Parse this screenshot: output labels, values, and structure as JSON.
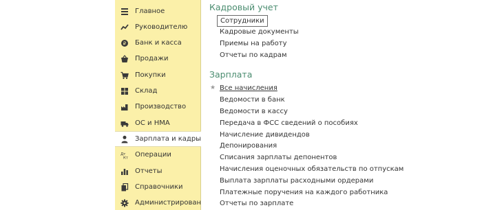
{
  "sidebar": {
    "items": [
      {
        "label": "Главное",
        "icon": "menu-lines-icon"
      },
      {
        "label": "Руководителю",
        "icon": "trend-chart-icon"
      },
      {
        "label": "Банк и касса",
        "icon": "coin-icon"
      },
      {
        "label": "Продажи",
        "icon": "shopping-basket-icon"
      },
      {
        "label": "Покупки",
        "icon": "shopping-cart-icon"
      },
      {
        "label": "Склад",
        "icon": "warehouse-grid-icon"
      },
      {
        "label": "Производство",
        "icon": "factory-icon"
      },
      {
        "label": "ОС и НМА",
        "icon": "truck-icon"
      },
      {
        "label": "Зарплата и кадры",
        "icon": "person-icon",
        "active": true
      },
      {
        "label": "Операции",
        "icon": "debit-credit-icon"
      },
      {
        "label": "Отчеты",
        "icon": "bar-chart-icon"
      },
      {
        "label": "Справочники",
        "icon": "books-icon"
      },
      {
        "label": "Администрирование",
        "icon": "gear-icon"
      }
    ]
  },
  "hr_section": {
    "title": "Кадровый учет",
    "links": [
      "Сотрудники",
      "Кадровые документы",
      "Приемы на работу",
      "Отчеты по кадрам"
    ]
  },
  "payroll_section": {
    "title": "Зарплата",
    "links": [
      "Все начисления",
      "Ведомости в банк",
      "Ведомости в кассу",
      "Передача в ФСС сведений о пособиях",
      "Начисление дивидендов",
      "Депонирования",
      "Списания зарплаты депонентов",
      "Начисления оценочных обязательств по отпускам",
      "Выплата зарплаты расходными ордерами",
      "Платежные поручения на каждого работника",
      "Отчеты по зарплате"
    ]
  },
  "colors": {
    "sidebar_bg": "#fbf0a9",
    "section_title": "#4a8c6f",
    "text": "#333333"
  }
}
